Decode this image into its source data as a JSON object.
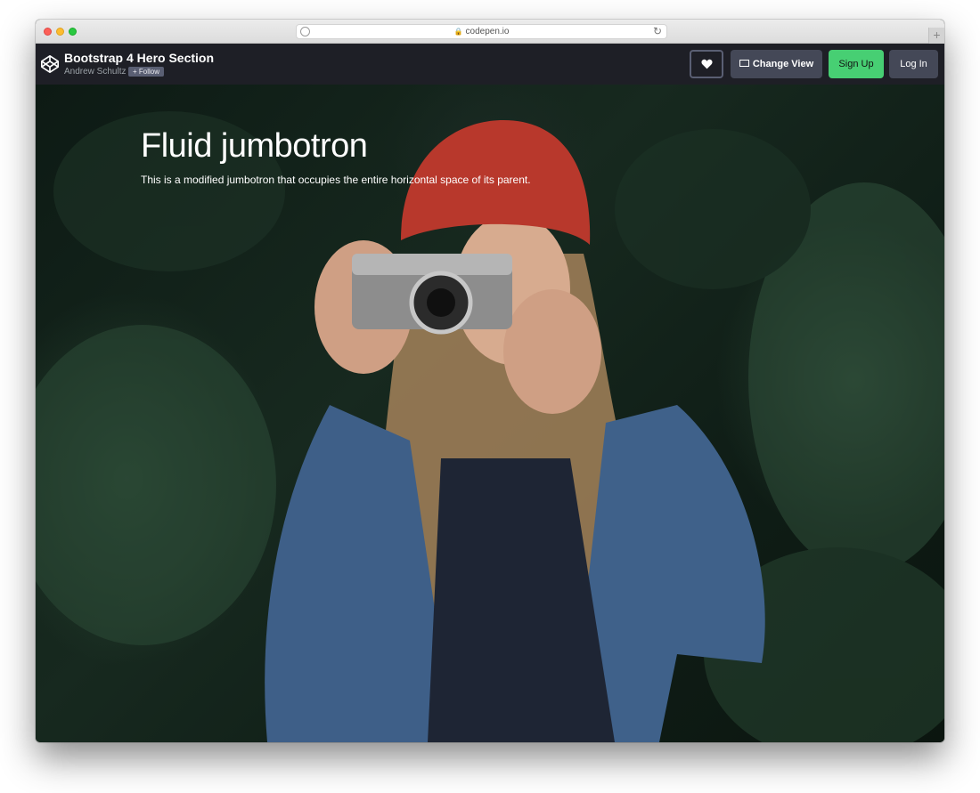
{
  "browser": {
    "url": "codepen.io",
    "lock_icon": "lock-icon",
    "reload_icon": "reload-icon",
    "newtab_label": "+"
  },
  "header": {
    "logo_icon": "codepen-logo-icon",
    "title": "Bootstrap 4 Hero Section",
    "author": "Andrew Schultz",
    "follow_label": "+ Follow",
    "heart_icon": "heart-icon",
    "change_view_label": "Change View",
    "change_view_icon": "change-view-icon",
    "signup_label": "Sign Up",
    "login_label": "Log In"
  },
  "hero": {
    "title": "Fluid jumbotron",
    "lead": "This is a modified jumbotron that occupies the entire horizontal space of its parent."
  },
  "colors": {
    "header_bg": "#1e1f26",
    "button_bg": "#444857",
    "signup_green": "#47cf73",
    "hero_dark": "#0f1d16"
  }
}
